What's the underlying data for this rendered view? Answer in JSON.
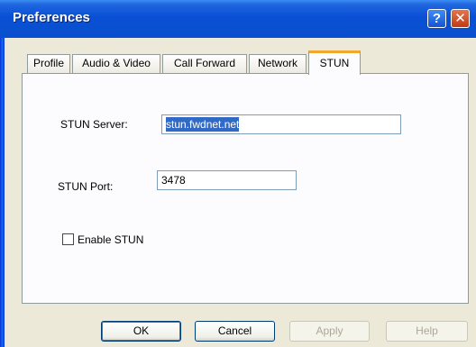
{
  "window": {
    "title": "Preferences",
    "help_glyph": "?",
    "close_glyph": "✕"
  },
  "tabs": [
    {
      "label": "Profile",
      "active": false
    },
    {
      "label": "Audio & Video",
      "active": false
    },
    {
      "label": "Call Forward",
      "active": false
    },
    {
      "label": "Network",
      "active": false
    },
    {
      "label": "STUN",
      "active": true
    }
  ],
  "stun": {
    "server_label": "STUN Server:",
    "server_value": "stun.fwdnet.net",
    "port_label": "STUN Port:",
    "port_value": "3478",
    "enable_label": "Enable STUN",
    "enable_checked": false
  },
  "buttons": {
    "ok": "OK",
    "cancel": "Cancel",
    "apply": "Apply",
    "help": "Help"
  },
  "colors": {
    "title_bar": "#0a4fd6",
    "active_tab_accent": "#f0a830",
    "selection": "#316ac5",
    "close_button": "#c23a14"
  },
  "icons": {
    "help": "help-icon",
    "close": "close-icon"
  }
}
